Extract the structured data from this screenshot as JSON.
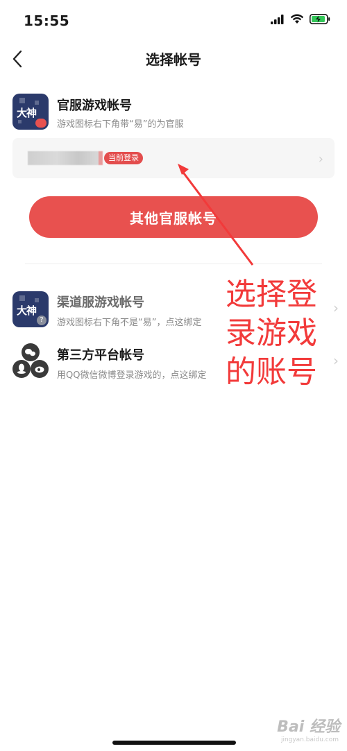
{
  "status_bar": {
    "time": "15:55"
  },
  "nav": {
    "title": "选择帐号"
  },
  "official": {
    "icon_text": "大神",
    "title": "官服游戏帐号",
    "desc": "游戏图标右下角带“易”的为官服",
    "current_badge": "当前登录",
    "other_button": "其他官服帐号"
  },
  "channel": {
    "icon_text": "大神",
    "title": "渠道服游戏帐号",
    "desc": "游戏图标右下角不是“易”，点这绑定"
  },
  "third_party": {
    "title": "第三方平台帐号",
    "desc": "用QQ微信微博登录游戏的，点这绑定"
  },
  "annotation": {
    "lines": [
      "选择登",
      "录游戏",
      "的账号"
    ]
  },
  "watermark": {
    "text": "Bai 经验",
    "sub": "jingyan.baidu.com"
  },
  "colors": {
    "accent": "#e8514f",
    "annotation": "#f23a3a",
    "icon_bg": "#2b3a6b"
  }
}
